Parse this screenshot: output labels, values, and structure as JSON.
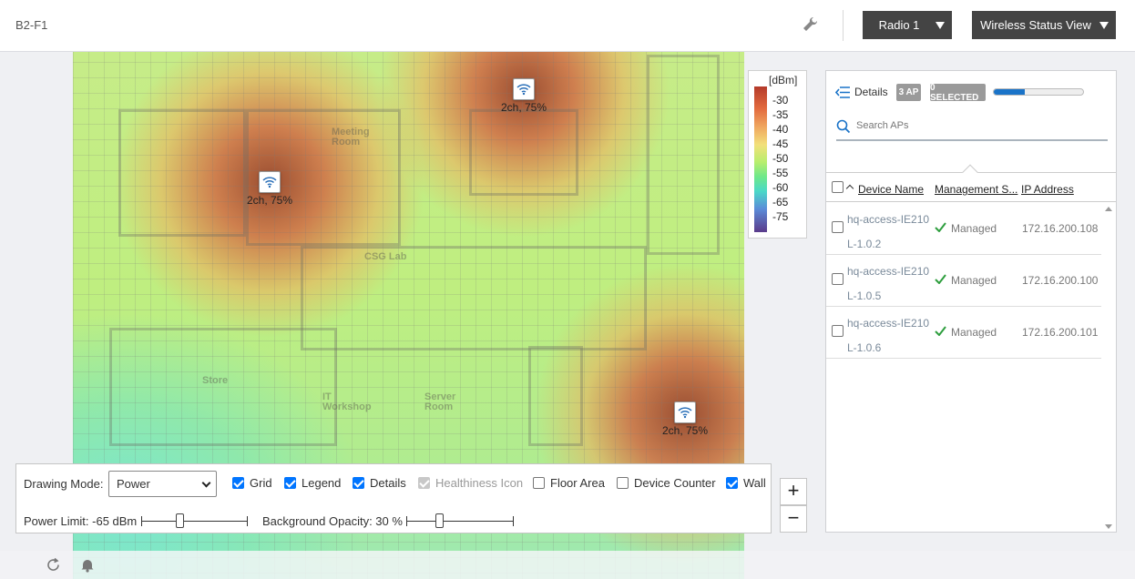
{
  "topbar": {
    "floor_name": "B2-F1",
    "radio_label": "Radio 1",
    "view_label": "Wireless Status View"
  },
  "map": {
    "rooms": [
      "Meeting Room",
      "CSG Lab",
      "Store",
      "IT Workshop",
      "Server Room"
    ],
    "aps": [
      {
        "label": "2ch, 75%"
      },
      {
        "label": "2ch, 75%"
      },
      {
        "label": "2ch, 75%"
      }
    ]
  },
  "legend": {
    "unit": "[dBm]",
    "ticks": [
      "-30",
      "-35",
      "-40",
      "-45",
      "-50",
      "-55",
      "-60",
      "-65",
      "-75"
    ]
  },
  "panel": {
    "details_label": "Details",
    "ap_count_badge": "3 AP",
    "selected_badge": "0 SELECTED",
    "progress": 0.35,
    "search_placeholder": "Search APs",
    "columns": [
      "Device Name",
      "Management S...",
      "IP Address"
    ],
    "rows": [
      {
        "name_line1": "hq-access-IE210",
        "name_line2": "L-1.0.2",
        "status": "Managed",
        "ip": "172.16.200.108"
      },
      {
        "name_line1": "hq-access-IE210",
        "name_line2": "L-1.0.5",
        "status": "Managed",
        "ip": "172.16.200.100"
      },
      {
        "name_line1": "hq-access-IE210",
        "name_line2": "L-1.0.6",
        "status": "Managed",
        "ip": "172.16.200.101"
      }
    ]
  },
  "controls": {
    "drawing_mode_label": "Drawing Mode:",
    "drawing_mode_value": "Power",
    "checkboxes": [
      {
        "label": "Grid",
        "checked": true
      },
      {
        "label": "Legend",
        "checked": true
      },
      {
        "label": "Details",
        "checked": true
      },
      {
        "label": "Healthiness Icon",
        "checked": true,
        "disabled": true
      },
      {
        "label": "Floor Area",
        "checked": false
      },
      {
        "label": "Device Counter",
        "checked": false
      },
      {
        "label": "Wall",
        "checked": true
      }
    ],
    "power_limit_label": "Power Limit: -65 dBm",
    "opacity_label": "Background Opacity: 30 %"
  },
  "zoom": {
    "in": "+",
    "out": "−"
  },
  "colors": {
    "accent": "#1a73c8",
    "managed": "#2e9e3e",
    "button_dark": "#444444"
  }
}
